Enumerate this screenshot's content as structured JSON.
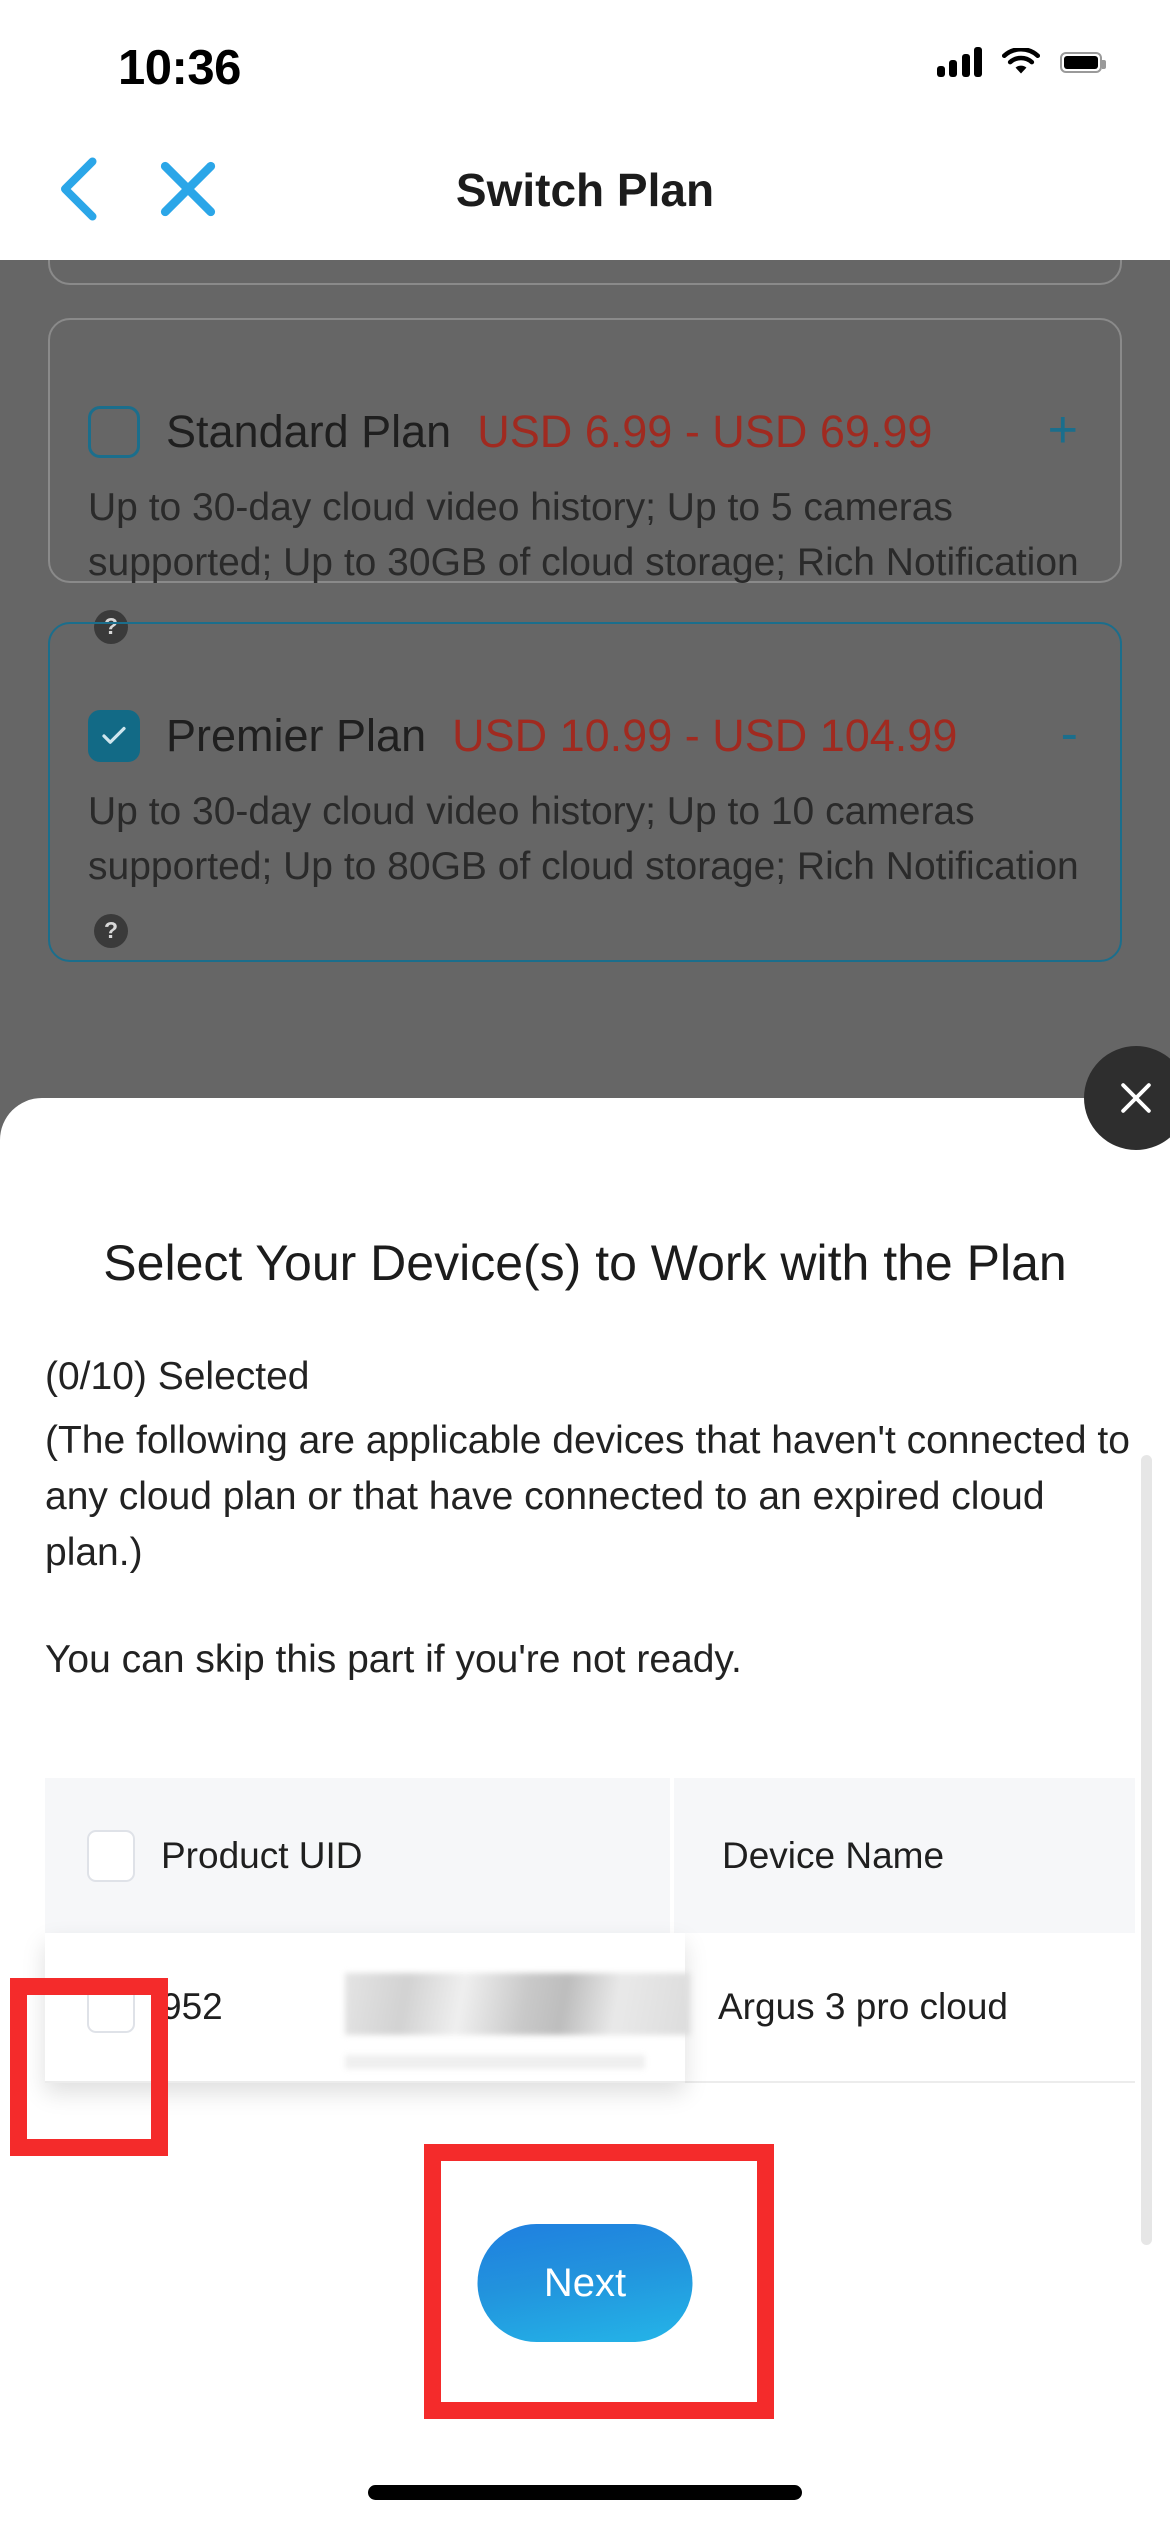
{
  "status_bar": {
    "time": "10:36",
    "signal_icon": "cellular-signal-icon",
    "wifi_icon": "wifi-icon",
    "battery_icon": "battery-icon"
  },
  "nav": {
    "title": "Switch Plan",
    "back_icon": "chevron-left-icon",
    "close_icon": "close-icon",
    "accent_color": "#2ba6e8"
  },
  "plans": [
    {
      "name": "Standard Plan",
      "price": "USD 6.99 - USD 69.99",
      "description": "Up to 30-day cloud video history; Up to 5 cameras supported; Up to 30GB of cloud storage; Rich Notification",
      "help_icon": "question-mark-icon",
      "toggle_label": "+",
      "selected": false
    },
    {
      "name": "Premier Plan",
      "price": "USD 10.99 - USD 104.99",
      "description": "Up to 30-day cloud video history; Up to 10 cameras supported; Up to 80GB of cloud storage; Rich Notification",
      "help_icon": "question-mark-icon",
      "toggle_label": "-",
      "selected": true
    }
  ],
  "price_color": "#a02a20",
  "sheet": {
    "close_icon": "close-circle-icon",
    "title": "Select Your Device(s) to Work with the Plan",
    "selected_count": "(0/10) Selected",
    "note": "(The following are applicable devices that haven't connected to any cloud plan or that have connected to an expired cloud plan.)",
    "skip_note": "You can skip this part if you're not ready.",
    "table": {
      "columns": [
        "Product UID",
        "Device Name"
      ],
      "rows": [
        {
          "uid": "952",
          "uid_redacted": true,
          "device_name": "Argus 3 pro cloud",
          "checked": false
        }
      ]
    },
    "next_label": "Next",
    "next_color_start": "#1f7fe0",
    "next_color_end": "#24b5e8"
  },
  "annotations": {
    "highlight_color": "#f42b2b",
    "boxes": [
      "row-checkbox",
      "next-button"
    ]
  }
}
